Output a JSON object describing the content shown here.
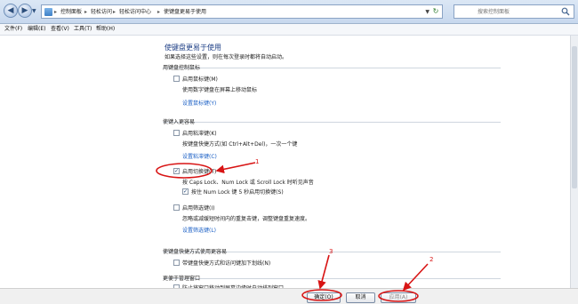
{
  "address": {
    "crumbs": [
      "控制面板",
      "轻松访问",
      "轻松访问中心",
      "使键盘更易于使用"
    ],
    "separator": "▸",
    "search_placeholder": "搜索控制面板"
  },
  "menu": [
    "文件(F)",
    "编辑(E)",
    "查看(V)",
    "工具(T)",
    "帮助(H)"
  ],
  "page": {
    "title": "使键盘更易于使用",
    "subtitle": "如果选择这些设置，则在每次登录时都将自动启动。"
  },
  "sections": {
    "mouse_keys": {
      "header": "用键盘控制鼠标",
      "checkbox": "启用鼠标键(M)",
      "checked": false,
      "desc": "使用数字键盘在屏幕上移动鼠标",
      "link": "设置鼠标键(Y)"
    },
    "typing": {
      "header": "使键入更容易",
      "sticky": {
        "checkbox": "启用粘滞键(K)",
        "checked": false,
        "desc": "按键盘快捷方式(如 Ctrl+Alt+Del)，一次一个键",
        "link": "设置粘滞键(C)"
      },
      "toggle": {
        "checkbox": "启用切换键(T)",
        "checked": true,
        "desc": "按 Caps Lock、Num Lock 或 Scroll Lock 时听见声音",
        "sub_checkbox": "按住 Num Lock 键 5 秒启用切换键(S)",
        "sub_checked": true
      },
      "filter": {
        "checkbox": "启用筛选键(I)",
        "checked": false,
        "desc": "忽略或减缓短时间内的重复击键，调整键盘重复速度。",
        "link": "设置筛选键(L)"
      }
    },
    "shortcuts": {
      "header": "使键盘快捷方式使用更容易",
      "checkbox": "带键盘快捷方式和访问键加下划线(N)",
      "checked": false
    },
    "windows": {
      "header": "更便于管理窗口",
      "checkbox": "防止将窗口移动到屏幕边缘时自动排列窗口",
      "checked": false
    }
  },
  "buttons": {
    "ok": "确定(O)",
    "cancel": "取消",
    "apply": "应用(A)"
  },
  "annotations": [
    "1",
    "2",
    "3"
  ],
  "colors": {
    "annotation": "#d81414",
    "link": "#1a5fc5",
    "title": "#1e3f86"
  }
}
